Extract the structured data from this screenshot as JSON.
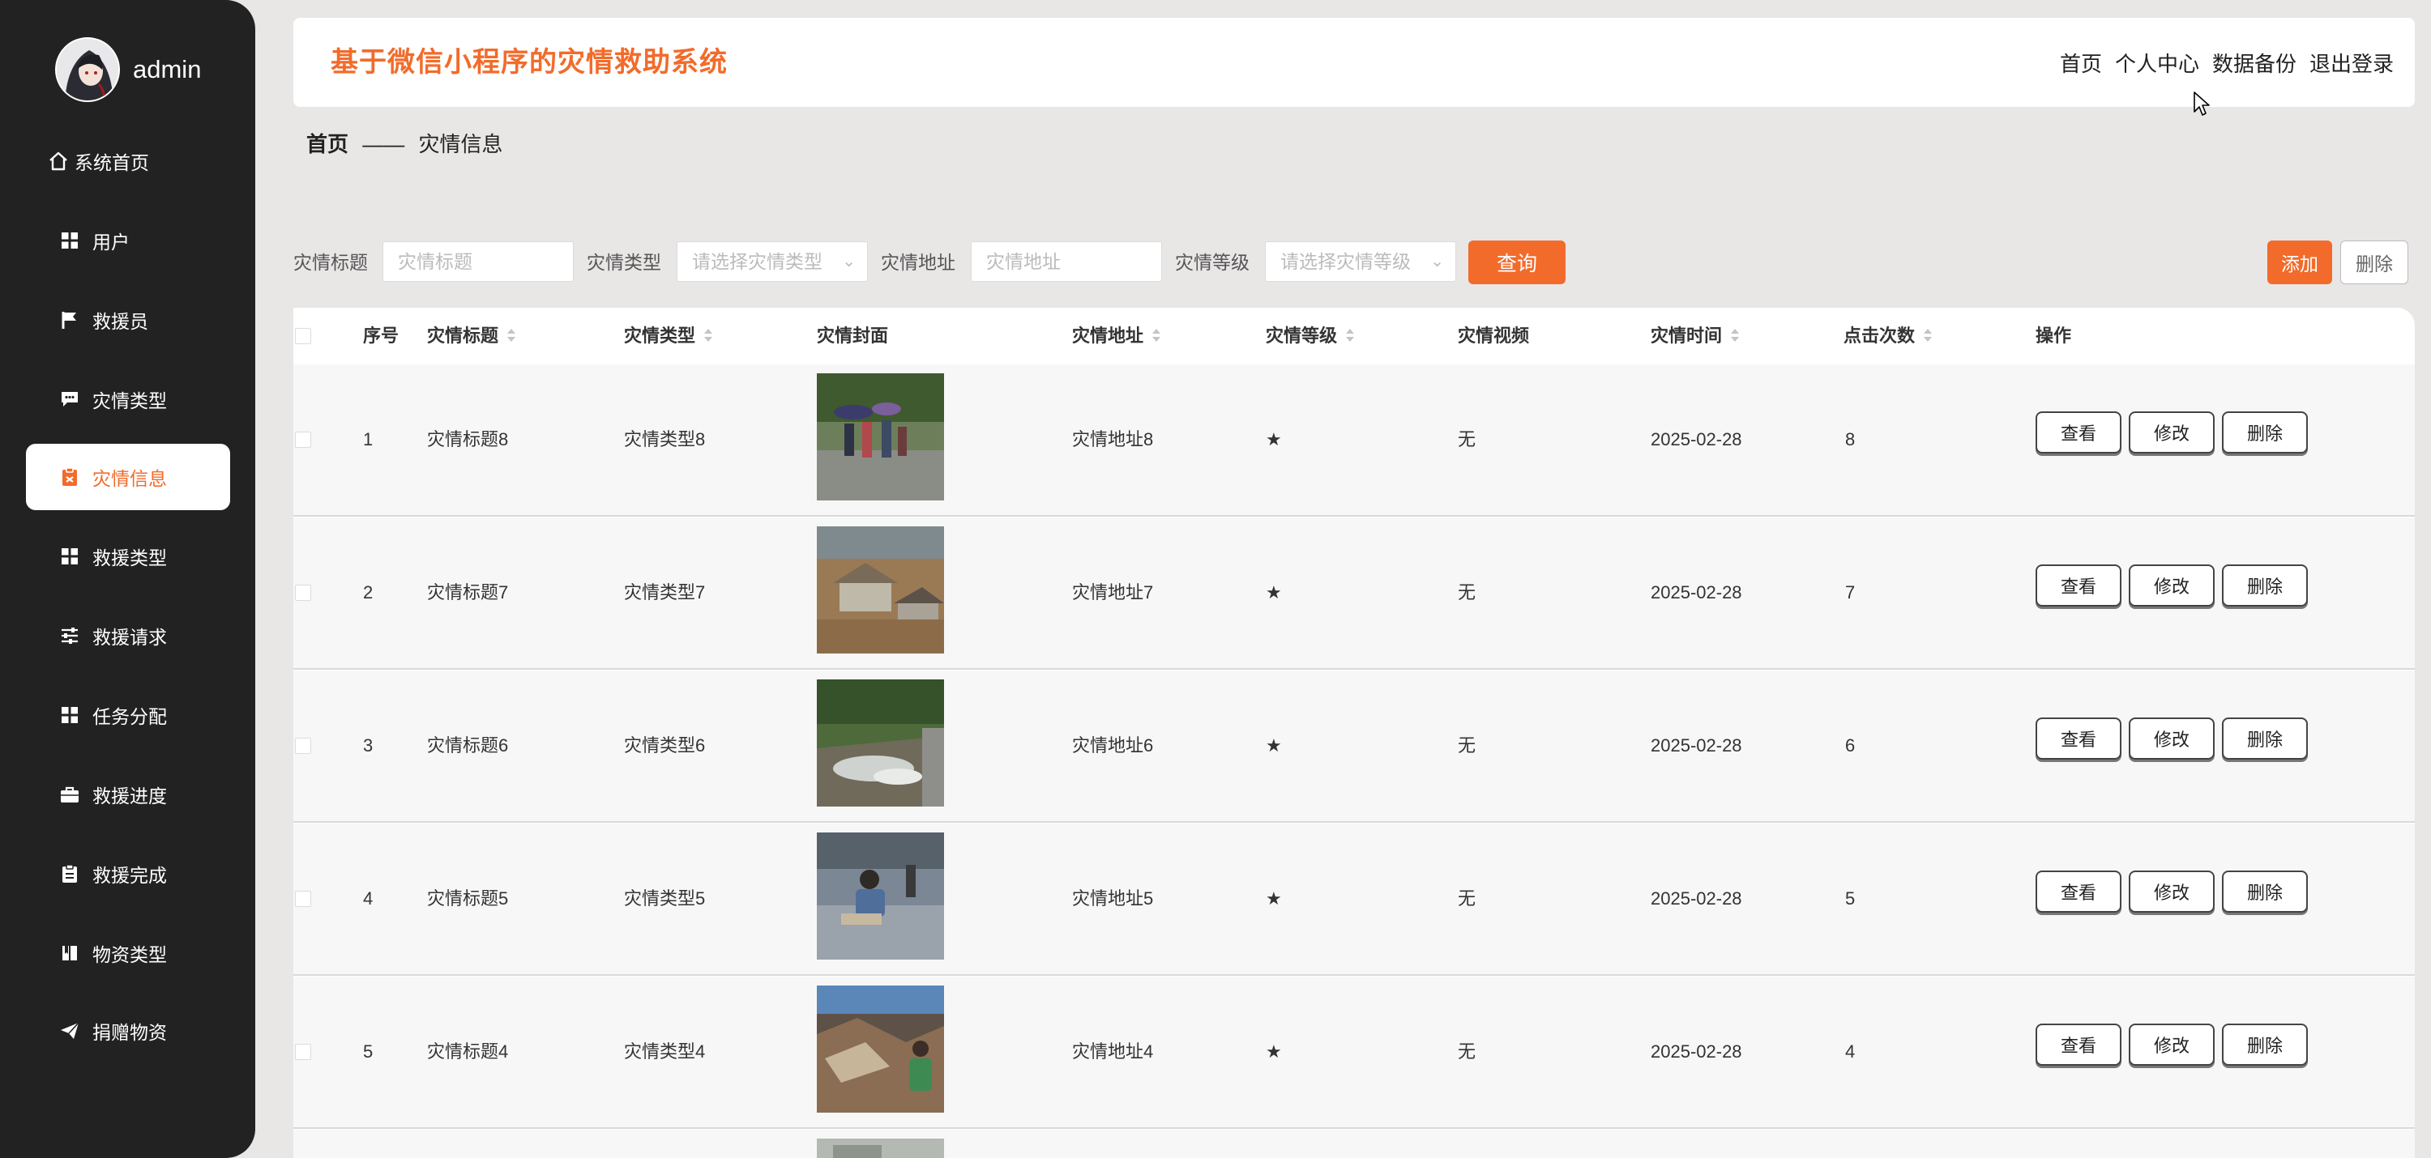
{
  "sidebar": {
    "username": "admin",
    "items": [
      {
        "label": "系统首页",
        "icon": "home-icon",
        "active": false
      },
      {
        "label": "用户",
        "icon": "grid-icon",
        "active": false
      },
      {
        "label": "救援员",
        "icon": "flag-icon",
        "active": false
      },
      {
        "label": "灾情类型",
        "icon": "chat-icon",
        "active": false
      },
      {
        "label": "灾情信息",
        "icon": "clipboard-icon",
        "active": true
      },
      {
        "label": "救援类型",
        "icon": "grid-icon",
        "active": false
      },
      {
        "label": "救援请求",
        "icon": "sliders-icon",
        "active": false
      },
      {
        "label": "任务分配",
        "icon": "grid-icon",
        "active": false
      },
      {
        "label": "救援进度",
        "icon": "briefcase-icon",
        "active": false
      },
      {
        "label": "救援完成",
        "icon": "clipboard-icon",
        "active": false
      },
      {
        "label": "物资类型",
        "icon": "book-icon",
        "active": false
      },
      {
        "label": "捐赠物资",
        "icon": "send-icon",
        "active": false
      }
    ]
  },
  "header": {
    "title": "基于微信小程序的灾情救助系统",
    "links": [
      "首页",
      "个人中心",
      "数据备份",
      "退出登录"
    ]
  },
  "breadcrumb": {
    "home": "首页",
    "sep": "——",
    "current": "灾情信息"
  },
  "filters": {
    "title_label": "灾情标题",
    "title_placeholder": "灾情标题",
    "type_label": "灾情类型",
    "type_placeholder": "请选择灾情类型",
    "address_label": "灾情地址",
    "address_placeholder": "灾情地址",
    "level_label": "灾情等级",
    "level_placeholder": "请选择灾情等级",
    "query_button": "查询",
    "add_button": "添加",
    "delete_button": "删除"
  },
  "table": {
    "columns": [
      "序号",
      "灾情标题",
      "灾情类型",
      "灾情封面",
      "灾情地址",
      "灾情等级",
      "灾情视频",
      "灾情时间",
      "点击次数",
      "操作"
    ],
    "actions": {
      "view": "查看",
      "edit": "修改",
      "delete": "删除"
    },
    "rows": [
      {
        "index": "1",
        "title": "灾情标题8",
        "type": "灾情类型8",
        "cover": "flood-street-people",
        "address": "灾情地址8",
        "level": "★",
        "video": "无",
        "time": "2025-02-28",
        "clicks": "8"
      },
      {
        "index": "2",
        "title": "灾情标题7",
        "type": "灾情类型7",
        "cover": "flooded-houses",
        "address": "灾情地址7",
        "level": "★",
        "video": "无",
        "time": "2025-02-28",
        "clicks": "7"
      },
      {
        "index": "3",
        "title": "灾情标题6",
        "type": "灾情类型6",
        "cover": "flood-water-road",
        "address": "灾情地址6",
        "level": "★",
        "video": "无",
        "time": "2025-02-28",
        "clicks": "6"
      },
      {
        "index": "4",
        "title": "灾情标题5",
        "type": "灾情类型5",
        "cover": "person-crouching-flood",
        "address": "灾情地址5",
        "level": "★",
        "video": "无",
        "time": "2025-02-28",
        "clicks": "5"
      },
      {
        "index": "5",
        "title": "灾情标题4",
        "type": "灾情类型4",
        "cover": "earthquake-rubble",
        "address": "灾情地址4",
        "level": "★",
        "video": "无",
        "time": "2025-02-28",
        "clicks": "4"
      }
    ]
  },
  "colors": {
    "accent": "#f26b2b",
    "sidebar_bg": "#222222",
    "page_bg": "#e9e6e6"
  }
}
